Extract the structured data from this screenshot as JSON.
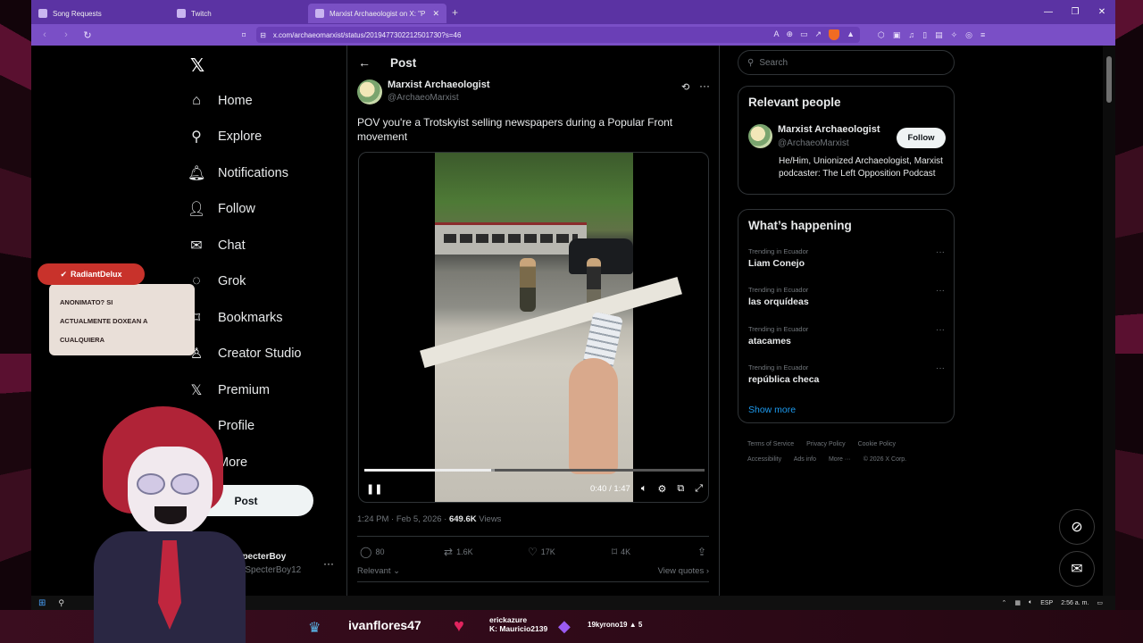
{
  "browser": {
    "tabs": [
      {
        "title": "Song Requests"
      },
      {
        "title": "Twitch"
      },
      {
        "title": "Marxist Archaeologist on X: \"P"
      }
    ],
    "url": "x.com/archaeomarxist/status/2019477302212501730?s=46"
  },
  "nav": {
    "items": [
      {
        "label": "Home",
        "icon": "home-icon"
      },
      {
        "label": "Explore",
        "icon": "search-icon"
      },
      {
        "label": "Notifications",
        "icon": "bell-icon"
      },
      {
        "label": "Follow",
        "icon": "add-user-icon"
      },
      {
        "label": "Chat",
        "icon": "mail-icon"
      },
      {
        "label": "Grok",
        "icon": "grok-icon"
      },
      {
        "label": "Bookmarks",
        "icon": "bookmark-icon"
      },
      {
        "label": "Creator Studio",
        "icon": "creator-icon"
      },
      {
        "label": "Premium",
        "icon": "x-icon"
      },
      {
        "label": "Profile",
        "icon": "person-icon"
      },
      {
        "label": "More",
        "icon": "more-circle-icon"
      }
    ],
    "post_label": "Post",
    "account_name": "TheSpecterBoy",
    "account_handle": "@TheSpecterBoy12"
  },
  "post": {
    "header": "Post",
    "author_name": "Marxist Archaeologist",
    "author_handle": "@ArchaeoMarxist",
    "text": "POV you're a Trotskyist selling newspapers during a Popular Front movement",
    "video_time": "0:40 / 1:47",
    "video_progress": 0.374,
    "timestamp": "1:24 PM · Feb 5, 2026 · ",
    "views_count": "649.6K",
    "views_label": " Views",
    "replies": "80",
    "reposts": "1.6K",
    "likes": "17K",
    "bookmarks": "4K",
    "sort_label": "Relevant ⌄",
    "view_quotes": "View quotes ›"
  },
  "sidebar": {
    "search_placeholder": "Search",
    "relevant_people_title": "Relevant people",
    "person_name": "Marxist Archaeologist",
    "person_handle": "@ArchaeoMarxist",
    "follow_label": "Follow",
    "person_bio": "He/Him, Unionized Archaeologist, Marxist podcaster: The Left Opposition Podcast",
    "happening_title": "What’s happening",
    "trends": [
      {
        "context": "Trending in Ecuador",
        "topic": "Liam Conejo"
      },
      {
        "context": "Trending in Ecuador",
        "topic": "las orquídeas"
      },
      {
        "context": "Trending in Ecuador",
        "topic": "atacames"
      },
      {
        "context": "Trending in Ecuador",
        "topic": "república checa"
      }
    ],
    "show_more": "Show more",
    "footer": [
      "Terms of Service",
      "Privacy Policy",
      "Cookie Policy",
      "Accessibility",
      "Ads info",
      "More ···",
      "© 2026 X Corp."
    ]
  },
  "taskbar": {
    "lang": "ESP",
    "time": "2:56 a. m."
  },
  "stream": {
    "chat_user": "RadiantDelux",
    "chat_message_lines": [
      "ANONIMATO? SI",
      "ACTUALMENTE DOXEAN A",
      "CUALQUIERA"
    ],
    "alert_user1": "ivanflores47",
    "alert_user2_line1": "erickazure",
    "alert_user2_line2": "K: Mauricio2139",
    "alert_user3": "19kyrono19",
    "alert_user3_count": "5"
  },
  "colors": {
    "accent_blue": "#1d9bf0",
    "browser_purple": "#5b33a3",
    "background": "#000000"
  }
}
